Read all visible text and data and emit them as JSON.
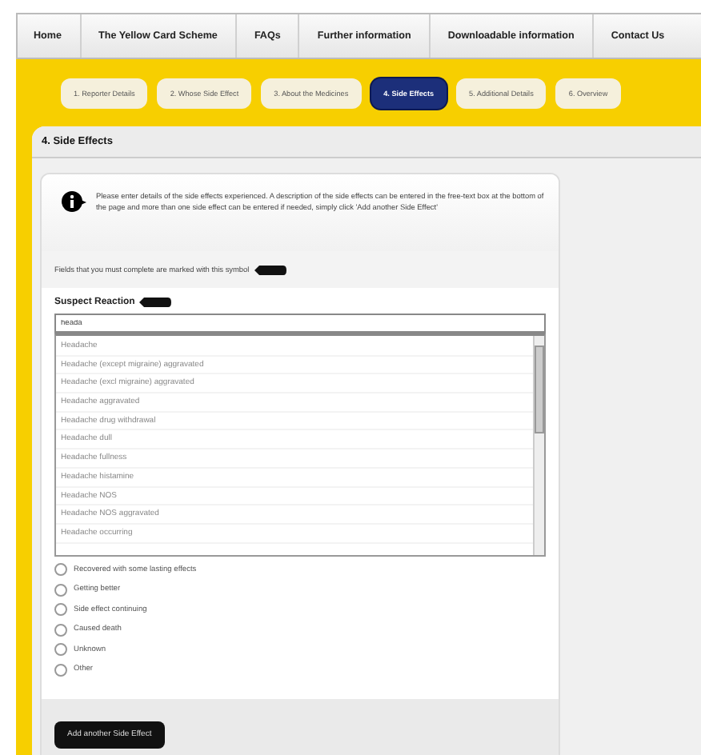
{
  "nav": [
    "Home",
    "The Yellow Card Scheme",
    "FAQs",
    "Further information",
    "Downloadable information",
    "Contact Us"
  ],
  "steps": [
    {
      "label": "1. Reporter Details",
      "selected": false
    },
    {
      "label": "2. Whose Side Effect",
      "selected": false
    },
    {
      "label": "3. About the Medicines",
      "selected": false
    },
    {
      "label": "4. Side Effects",
      "selected": true
    },
    {
      "label": "5. Additional Details",
      "selected": false
    },
    {
      "label": "6. Overview",
      "selected": false
    }
  ],
  "panel": {
    "title": "4. Side Effects"
  },
  "info": "Please enter details of the side effects experienced. A description of the side effects can be entered in the free-text box at the bottom of the page and more than one side effect can be entered if needed, simply click 'Add another Side Effect'",
  "required_note": "Fields that you must complete are marked with this symbol",
  "suspect_reaction": {
    "label": "Suspect Reaction",
    "value": "heada",
    "suggestions": [
      "Headache",
      "Headache (except migraine) aggravated",
      "Headache (excl migraine) aggravated",
      "Headache aggravated",
      "Headache drug withdrawal",
      "Headache dull",
      "Headache fullness",
      "Headache histamine",
      "Headache NOS",
      "Headache NOS aggravated",
      "Headache occurring"
    ]
  },
  "outcomes": [
    {
      "label": "Recovered with some lasting effects",
      "selected": false
    },
    {
      "label": "Getting better",
      "selected": false
    },
    {
      "label": "Side effect continuing",
      "selected": false
    },
    {
      "label": "Caused death",
      "selected": false
    },
    {
      "label": "Unknown",
      "selected": false
    },
    {
      "label": "Other",
      "selected": false
    }
  ],
  "add_button": "Add another Side Effect"
}
